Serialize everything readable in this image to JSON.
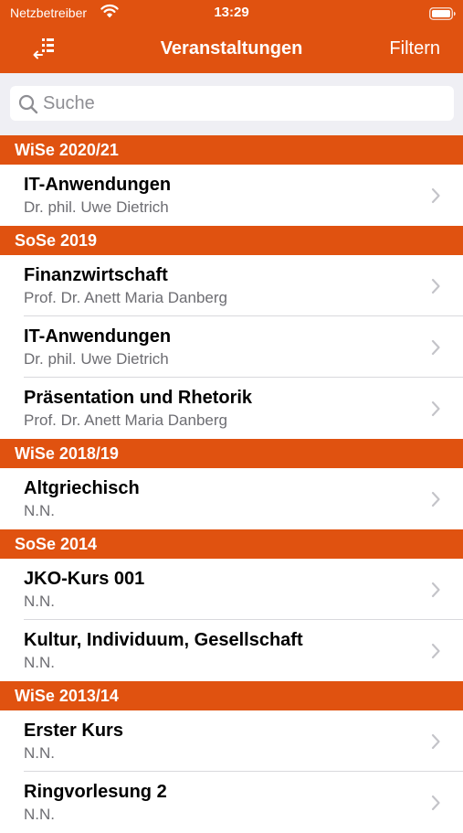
{
  "status_bar": {
    "carrier": "Netzbetreiber",
    "time": "13:29"
  },
  "nav": {
    "title": "Veranstaltungen",
    "filter_label": "Filtern",
    "sort_icon": "sort-list-icon"
  },
  "search": {
    "placeholder": "Suche",
    "value": ""
  },
  "colors": {
    "accent": "#e05210",
    "subtitle": "#6d6d72",
    "search_bg": "#efeff4"
  },
  "sections": [
    {
      "title": "WiSe 2020/21",
      "items": [
        {
          "title": "IT-Anwendungen",
          "subtitle": "Dr. phil. Uwe Dietrich"
        }
      ]
    },
    {
      "title": "SoSe 2019",
      "items": [
        {
          "title": "Finanzwirtschaft",
          "subtitle": "Prof. Dr. Anett Maria Danberg"
        },
        {
          "title": "IT-Anwendungen",
          "subtitle": "Dr. phil. Uwe Dietrich"
        },
        {
          "title": "Präsentation und Rhetorik",
          "subtitle": "Prof. Dr. Anett Maria Danberg"
        }
      ]
    },
    {
      "title": "WiSe 2018/19",
      "items": [
        {
          "title": "Altgriechisch",
          "subtitle": "N.N."
        }
      ]
    },
    {
      "title": "SoSe 2014",
      "items": [
        {
          "title": "JKO-Kurs 001",
          "subtitle": "N.N."
        },
        {
          "title": "Kultur, Individuum, Gesellschaft",
          "subtitle": "N.N."
        }
      ]
    },
    {
      "title": "WiSe 2013/14",
      "items": [
        {
          "title": "Erster Kurs",
          "subtitle": "N.N."
        },
        {
          "title": "Ringvorlesung 2",
          "subtitle": "N.N."
        }
      ]
    }
  ]
}
